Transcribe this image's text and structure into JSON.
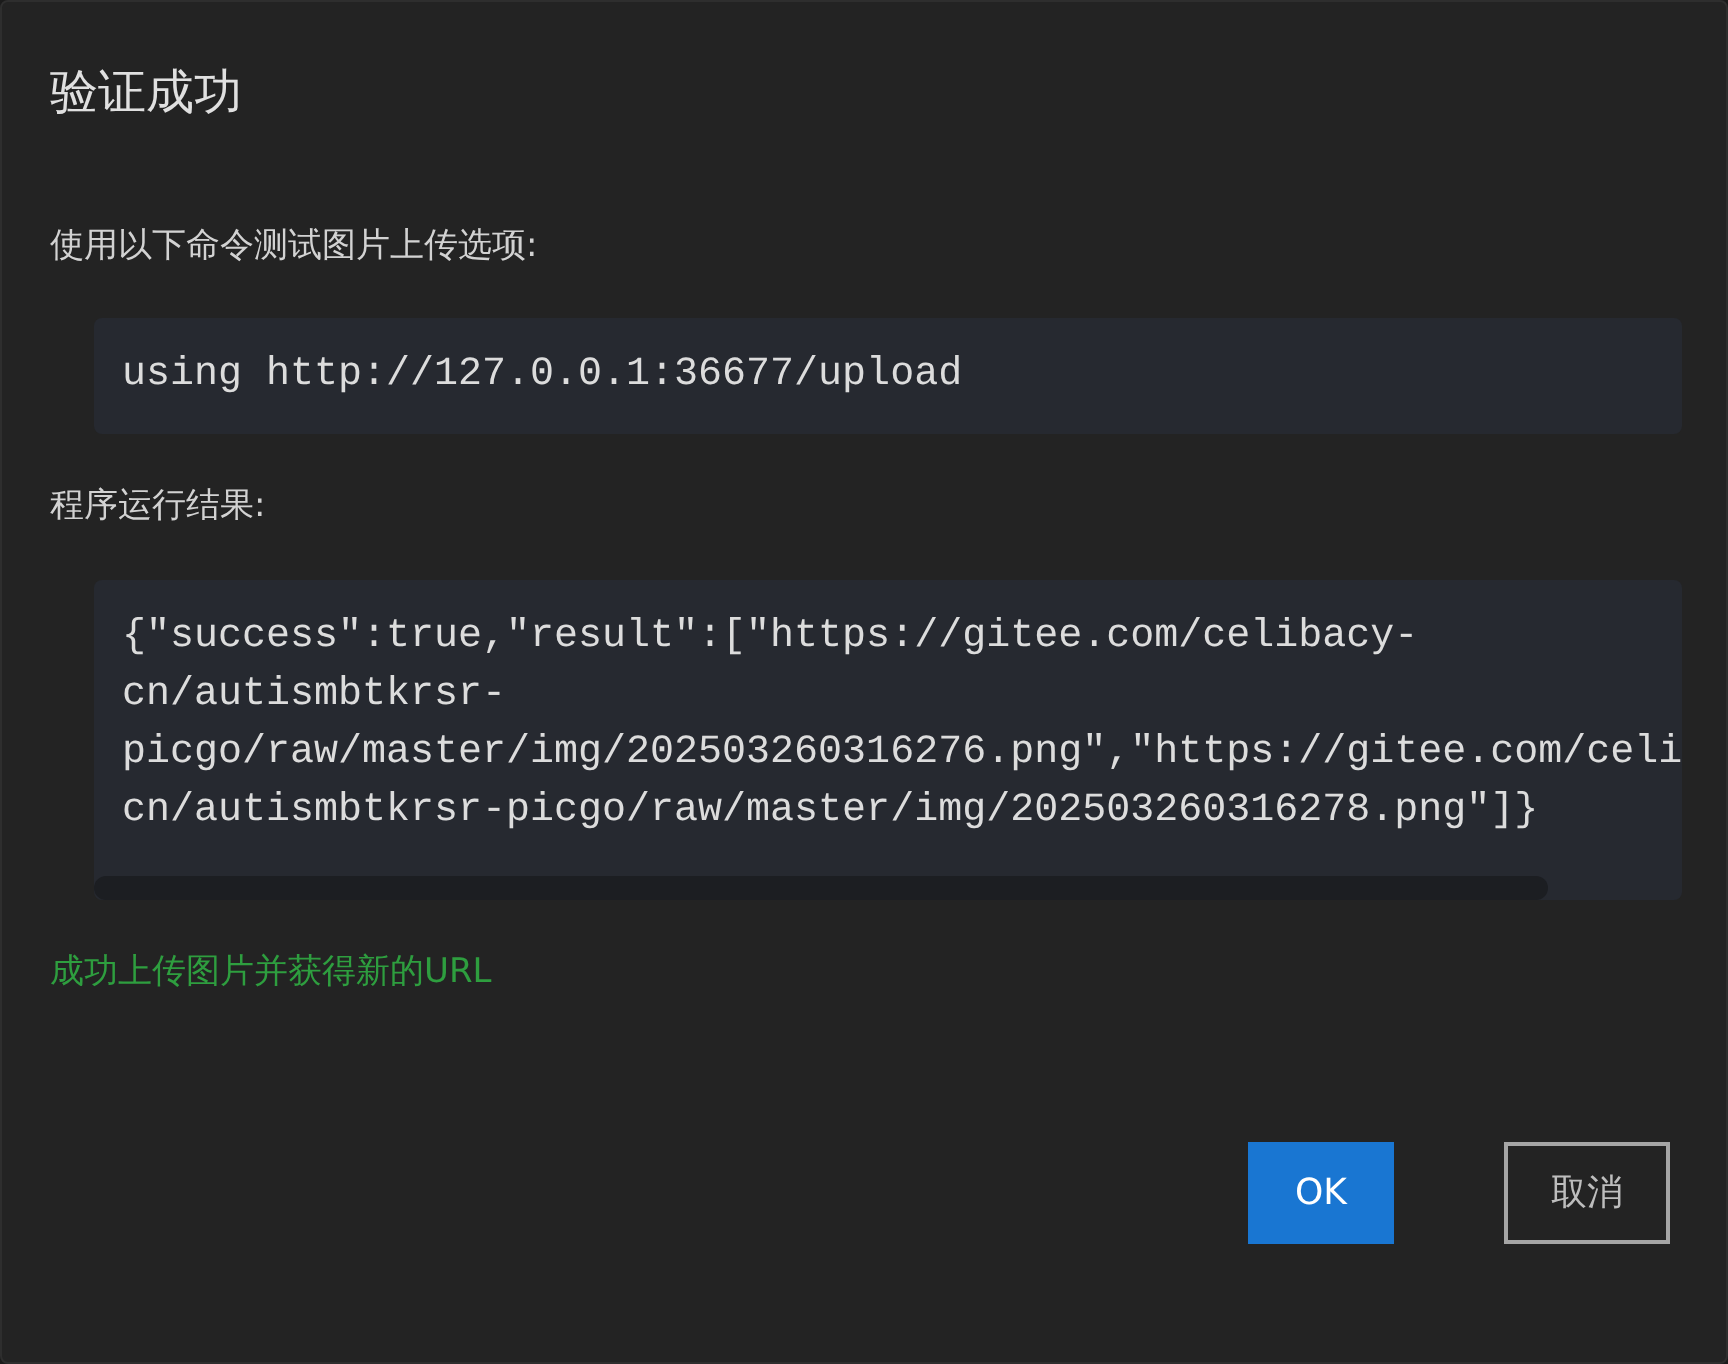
{
  "dialog": {
    "title": "验证成功"
  },
  "command_label": "使用以下命令测试图片上传选项:",
  "command": "using http://127.0.0.1:36677/upload",
  "result_label": "程序运行结果:",
  "result_lines": [
    "{\"success\":true,\"result\":[\"https://gitee.com/celibacy-",
    "cn/autismbtkrsr-",
    "picgo/raw/master/img/202503260316276.png\",\"https://gitee.com/celi",
    "cn/autismbtkrsr-picgo/raw/master/img/202503260316278.png\"]}"
  ],
  "status_message": "成功上传图片并获得新的URL",
  "buttons": [
    {
      "label": "OK",
      "kind": "primary"
    },
    {
      "label": "取消",
      "kind": "outline"
    }
  ]
}
